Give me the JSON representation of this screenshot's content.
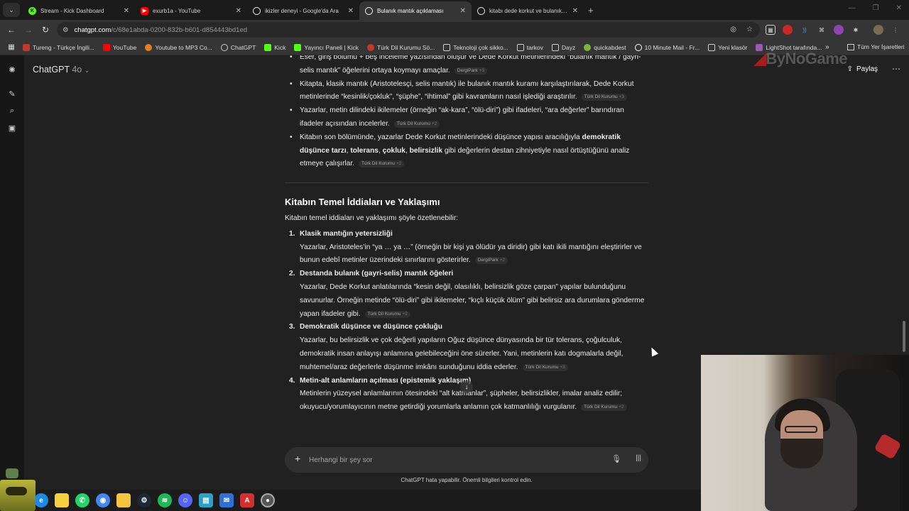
{
  "tabs": [
    {
      "title": "Stream - Kick Dashboard",
      "icon": "kick-icon",
      "color": "#53fc18"
    },
    {
      "title": "exurb1a - YouTube",
      "icon": "youtube-icon",
      "color": "#ff0000"
    },
    {
      "title": "ikizler deneyi - Google'da Ara",
      "icon": "google-icon",
      "color": "#ffffff"
    },
    {
      "title": "Bulanık mantık açıklaması",
      "icon": "chatgpt-icon",
      "color": "#ffffff",
      "active": true
    },
    {
      "title": "kitabı dede korkut ve bulanık m",
      "icon": "chatgpt-icon",
      "color": "#ffffff"
    }
  ],
  "address": {
    "host": "chatgpt.com",
    "path": "/c/68e1abda-0200-832b-b601-d854443bd1ed"
  },
  "bookmarks": [
    {
      "label": "Tureng - Türkçe İngili...",
      "icon": "tureng-icon",
      "color": "#c0392b"
    },
    {
      "label": "YouTube",
      "icon": "youtube-icon",
      "color": "#ff0000"
    },
    {
      "label": "Youtube to MP3 Co...",
      "icon": "converter-icon",
      "color": "#e67e22"
    },
    {
      "label": "ChatGPT",
      "icon": "chatgpt-icon",
      "color": "#cccccc"
    },
    {
      "label": "Kick",
      "icon": "kick-icon",
      "color": "#53fc18"
    },
    {
      "label": "Yayıncı Paneli | Kick",
      "icon": "kick-icon",
      "color": "#53fc18"
    },
    {
      "label": "Türk Dil Kurumu Sö...",
      "icon": "tdk-icon",
      "color": "#c0392b"
    },
    {
      "label": "Teknoloji çok sikko...",
      "icon": "folder-icon",
      "color": "#cccccc"
    },
    {
      "label": "tarkov",
      "icon": "folder-icon",
      "color": "#cccccc"
    },
    {
      "label": "Dayz",
      "icon": "folder-icon",
      "color": "#cccccc"
    },
    {
      "label": "quickabdest",
      "icon": "leaf-icon",
      "color": "#7cb342"
    },
    {
      "label": "10 Minute Mail - Fr...",
      "icon": "clock-icon",
      "color": "#ffffff"
    },
    {
      "label": "Yeni klasör",
      "icon": "folder-icon",
      "color": "#cccccc"
    },
    {
      "label": "LightShot tarafında...",
      "icon": "feather-icon",
      "color": "#9b59b6"
    }
  ],
  "bookmarks_all": "Tüm Yer İşaretleri",
  "header": {
    "model": "ChatGPT",
    "version": "4o",
    "share": "Paylaş"
  },
  "watermark": "ByNoGame",
  "bullets": [
    {
      "text": "Eser, giriş bölümü + beş inceleme yazısından oluşur ve Dede Korkut metinlerindeki “bulanık mantık / gayri-selis mantık” öğelerini ortaya koymayı amaçlar.",
      "cite": "DergiPark",
      "count": "+3"
    },
    {
      "text": "Kitapta, klasik mantık (Aristotelesçi, selis mantık) ile bulanık mantık kuramı karşılaştırılarak, Dede Korkut metinlerinde “kesinlik/çokluk”, “şüphe”, “ihtimal” gibi kavramların nasıl işlediği araştırılır.",
      "cite": "Türk Dil Kurumu",
      "count": "+3"
    },
    {
      "text": "Yazarlar, metin dilindeki ikilemeler (örneğin “ak-kara”, “ölü-diri”) gibi ifadeleri, “ara değerler” barındıran ifadeler açısından incelerler.",
      "cite": "Türk Dil Kurumu",
      "count": "+2"
    },
    {
      "pre": "Kitabın son bölümünde, yazarlar Dede Korkut metinlerindeki düşünce yapısı aracılığıyla ",
      "b1": "demokratik düşünce tarzı",
      "s1": ", ",
      "b2": "tolerans",
      "s2": ", ",
      "b3": "çokluk",
      "s3": ", ",
      "b4": "belirsizlik",
      "post": " gibi değerlerin destan zihniyetiyle nasıl örtüştüğünü analiz etmeye çalışırlar.",
      "cite": "Türk Dil Kurumu",
      "count": "+2"
    }
  ],
  "section": {
    "title": "Kitabın Temel İddiaları ve Yaklaşımı",
    "intro": "Kitabın temel iddiaları ve yaklaşımı şöyle özetlenebilir:",
    "items": [
      {
        "num": "1.",
        "title": "Klasik mantığın yetersizliği",
        "text": "Yazarlar, Aristoteles’in “ya … ya …” (örneğin bir kişi ya ölüdür ya diridir) gibi katı ikili mantığını eleştirirler ve bunun edebî metinler üzerindeki sınırlarını gösterirler.",
        "cite": "DergiPark",
        "count": "+2"
      },
      {
        "num": "2.",
        "title": "Destanda bulanık (gayri-selis) mantık öğeleri",
        "text": "Yazarlar, Dede Korkut anlatılarında “kesin değil, olasılıklı, belirsizlik göze çarpan” yapılar bulunduğunu savunurlar. Örneğin metinde “ölü-diri” gibi ikilemeler, “kıçlı küçük ölüm” gibi belirsiz ara durumlara gönderme yapan ifadeler gibi.",
        "cite": "Türk Dil Kurumu",
        "count": "+2"
      },
      {
        "num": "3.",
        "title": "Demokratik düşünce ve düşünce çokluğu",
        "text": "Yazarlar, bu belirsizlik ve çok değerli yapıların Oğuz düşünce dünyasında bir tür tolerans, çoğulculuk, demokratik insan anlayışı anlamına gelebileceğini öne sürerler. Yani, metinlerin katı dogmalarla değil, muhtemel/araz değerlerle düşünme imkânı sunduğunu iddia ederler.",
        "cite": "Türk Dil Kurumu",
        "count": "+3"
      },
      {
        "num": "4.",
        "title": "Metin-alt anlamların açılması (epistemik yaklaşım)",
        "text": "Metinlerin yüzeysel anlamlarının ötesindeki “alt katmanlar”, şüpheler, belirsizlikler, imalar analiz edilir; okuyucu/yorumlayıcının metne getirdiği yorumlarla anlamın çok katmanlılığı vurgulanır.",
        "cite": "Türk Dil Kurumu",
        "count": "+2"
      }
    ]
  },
  "composer": {
    "placeholder": "Herhangi bir şey sor"
  },
  "disclaimer": "ChatGPT hata yapabilir. Önemli bilgileri kontrol edin.",
  "taskbar": [
    {
      "icon": "edge-icon",
      "color": "#1e88e5"
    },
    {
      "icon": "sticky-notes-icon",
      "color": "#f4d03f"
    },
    {
      "icon": "whatsapp-icon",
      "color": "#25d366"
    },
    {
      "icon": "chrome-icon",
      "color": "#4285f4"
    },
    {
      "icon": "file-explorer-icon",
      "color": "#f5c542"
    },
    {
      "icon": "steam-icon",
      "color": "#1b2838"
    },
    {
      "icon": "spotify-icon",
      "color": "#1db954"
    },
    {
      "icon": "discord-icon",
      "color": "#5865f2"
    },
    {
      "icon": "photos-icon",
      "color": "#2ea0c7"
    },
    {
      "icon": "mail-icon",
      "color": "#2f6fd6"
    },
    {
      "icon": "acrobat-icon",
      "color": "#d32f2f"
    },
    {
      "icon": "obs-icon",
      "color": "#555555"
    }
  ]
}
